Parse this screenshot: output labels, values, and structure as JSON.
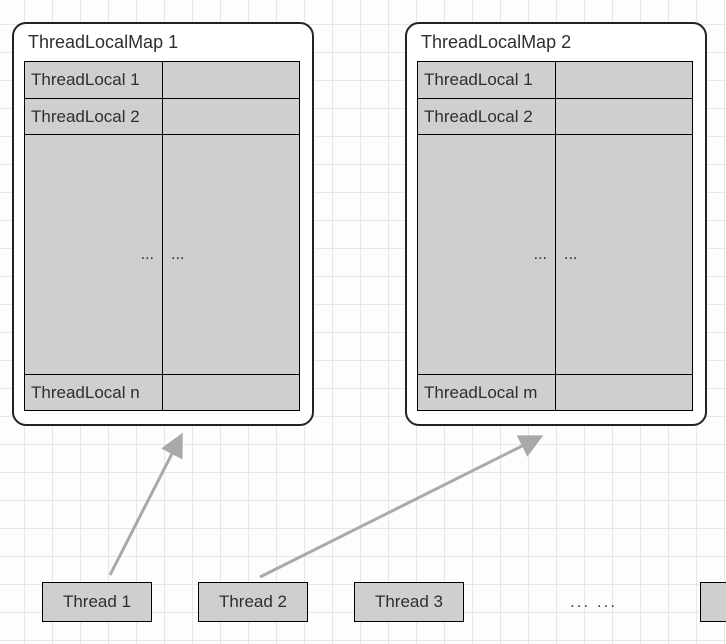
{
  "maps": [
    {
      "title": "ThreadLocalMap 1",
      "rows": [
        {
          "key": "ThreadLocal 1",
          "val": ""
        },
        {
          "key": "ThreadLocal 2",
          "val": ""
        },
        {
          "ellipsis_key": "...",
          "ellipsis_val": "..."
        },
        {
          "key": "ThreadLocal n",
          "val": ""
        }
      ]
    },
    {
      "title": "ThreadLocalMap 2",
      "rows": [
        {
          "key": "ThreadLocal 1",
          "val": ""
        },
        {
          "key": "ThreadLocal 2",
          "val": ""
        },
        {
          "ellipsis_key": "...",
          "ellipsis_val": "..."
        },
        {
          "key": "ThreadLocal m",
          "val": ""
        }
      ]
    }
  ],
  "threads": [
    {
      "label": "Thread 1"
    },
    {
      "label": "Thread 2"
    },
    {
      "label": "Thread 3"
    }
  ],
  "threads_more": "... ..."
}
